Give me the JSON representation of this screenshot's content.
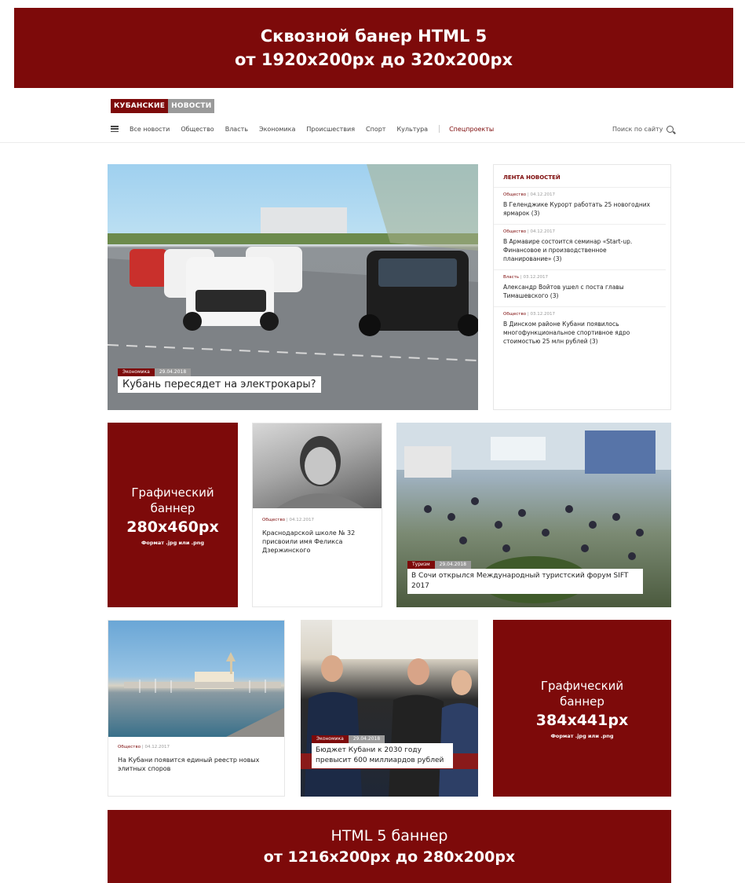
{
  "top_banner": {
    "line1": "Сквозной банер HTML 5",
    "line2": "от 1920x200px до 320x200px"
  },
  "header": {
    "logo_part1": "КУБАНСКИЕ",
    "logo_part2": "НОВОСТИ",
    "nav": [
      "Все новости",
      "Общество",
      "Власть",
      "Экономика",
      "Происшествия",
      "Спорт",
      "Культура"
    ],
    "nav_special": "Спецпроекты",
    "search_label": "Поиск по сайту"
  },
  "hero": {
    "category": "Экономика",
    "date": "29.04.2018",
    "title": "Кубань пересядет на электрокары?"
  },
  "feed": {
    "title": "ЛЕНТА НОВОСТЕЙ",
    "items": [
      {
        "category": "Общество",
        "date": "04.12.2017",
        "text": "В Геленджике Курорт работать 25 новогодних ярмарок (3)"
      },
      {
        "category": "Общество",
        "date": "04.12.2017",
        "text": "В Армавире состоится семинар «Start-up. Финансовое и производственное планирование» (3)"
      },
      {
        "category": "Власть",
        "date": "03.12.2017",
        "text": "Александр Войтов ушел с поста главы Тимашевского (3)"
      },
      {
        "category": "Общество",
        "date": "03.12.2017",
        "text": "В Динском районе Кубани появилось многофункциональное спортивное ядро стоимостью 25 млн рублей (3)"
      }
    ]
  },
  "banner_280": {
    "line1": "Графический",
    "line2": "баннер",
    "size": "280x460px",
    "format": "Формат .jpg или .png"
  },
  "card_portrait": {
    "category": "Общество",
    "date": "04.12.2017",
    "text": "Краснодарской школе № 32 присвоили имя Феликса Дзержинского"
  },
  "forum": {
    "category": "Туризм",
    "date": "29.04.2018",
    "title": "В Сочи открылся Международный туристский форум SIFT 2017"
  },
  "card_port": {
    "category": "Общество",
    "date": "04.12.2017",
    "text": "На Кубани появится единый реестр новых элитных споров"
  },
  "budget": {
    "category": "Экономика",
    "date": "29.04.2018",
    "title": "Бюджет Кубани к 2030 году превысит 600 миллиардов рублей"
  },
  "banner_384": {
    "line1": "Графический",
    "line2": "баннер",
    "size": "384x441px",
    "format": "Формат .jpg или .png"
  },
  "bottom_banner": {
    "line1": "HTML 5 баннер",
    "line2": "от 1216x200px до 280x200px"
  },
  "colors": {
    "brand": "#7d0a0a",
    "badge_gray": "#9a9a9a"
  }
}
